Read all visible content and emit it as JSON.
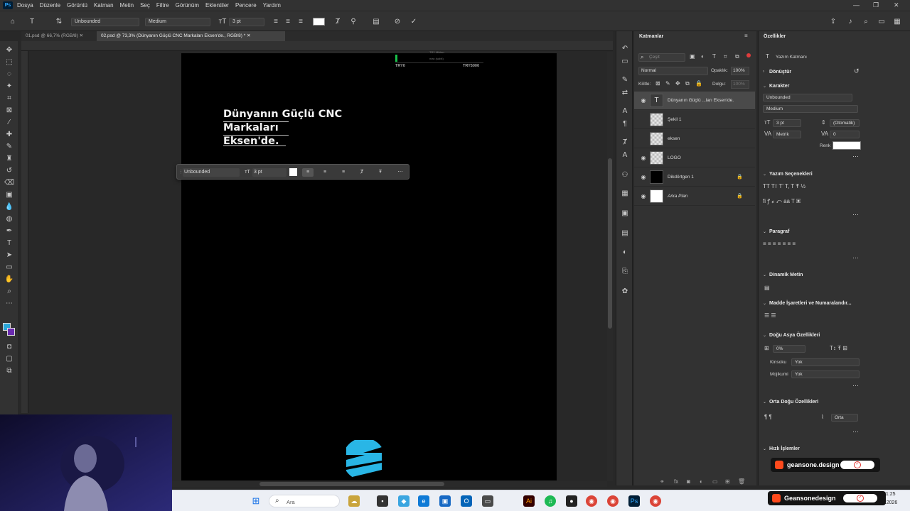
{
  "menubar": {
    "app_icon": "Ps",
    "items": [
      "Dosya",
      "Düzenle",
      "Görüntü",
      "Katman",
      "Metin",
      "Seç",
      "Filtre",
      "Görünüm",
      "Eklentiler",
      "Pencere",
      "Yardım"
    ]
  },
  "options": {
    "font_family": "Unbounded",
    "font_style": "Medium",
    "font_size": "3 pt"
  },
  "tabs": [
    {
      "label": "01.psd @ 66,7% (RGB/8)"
    },
    {
      "label": "02.psd @ 73,3% (Dünyanın Güçlü CNC Markaları Eksen'de., RGB/8) *"
    }
  ],
  "canvas": {
    "headline": "Dünyanın Güçlü CNC\nMarkaları\nEksen'de.",
    "top_label_left": "TRY0",
    "top_label_right": "TRY5000",
    "top_label_small": "TRY Miktarı",
    "top_label_small2": "max (sabit)"
  },
  "floating_bar": {
    "font_family": "Unbounded",
    "font_size": "3 pt"
  },
  "layers_panel": {
    "title": "Katmanlar",
    "search_placeholder": "Çeşit",
    "blend_mode": "Normal",
    "opacity_label": "Opaklık:",
    "opacity_value": "100%",
    "lock_label": "Kilitle:",
    "fill_label": "Dolgu:",
    "fill_value": "100%",
    "layers": [
      {
        "name": "Dünyanın Güçlü ...ları Eksen'de.",
        "visible": true,
        "selected": true
      },
      {
        "name": "Şekil 1",
        "visible": false,
        "selected": false
      },
      {
        "name": "eksen",
        "visible": false,
        "selected": false
      },
      {
        "name": "LOGO",
        "visible": true,
        "selected": false
      },
      {
        "name": "Dikdörtgen 1",
        "visible": true,
        "selected": false
      },
      {
        "name": "Arka Plan",
        "visible": true,
        "selected": false
      }
    ]
  },
  "properties_panel": {
    "title": "Özellikler",
    "type_label": "Yazım Katmanı",
    "section_transform": "Dönüştür",
    "section_character": "Karakter",
    "char_font": "Unbounded",
    "char_style": "Medium",
    "char_size": "3 pt",
    "char_leading": "(Otomatik)",
    "char_kerning": "Metrik",
    "char_tracking": "0",
    "color_label": "Renk",
    "section_typography": "Yazım Seçenekleri",
    "section_paragraph": "Paragraf",
    "section_dynamic": "Dinamik Metin",
    "section_bullets": "Madde İşaretleri ve Numaralandır...",
    "section_east_asian": "Doğu Asya Özellikleri",
    "ea_percent": "0%",
    "kinsoku_label": "Kinsoku",
    "kinsoku_value": "Yok",
    "mojikumi_label": "Mojikumi",
    "mojikumi_value": "Yok",
    "section_middle_east": "Orta Doğu Özellikleri",
    "me_value": "Orta",
    "section_quick": "Hızlı İşlemler"
  },
  "badges": {
    "small": "geansone.design",
    "large": "Geansonedesign"
  },
  "taskbar": {
    "search_label": "Ara",
    "time": "21:25",
    "date": "…02.2026"
  },
  "colors": {
    "accent": "#31a8ff",
    "artboard": "#000000",
    "logo_blue": "#29b6e6",
    "indicator_green": "#19c04a"
  }
}
